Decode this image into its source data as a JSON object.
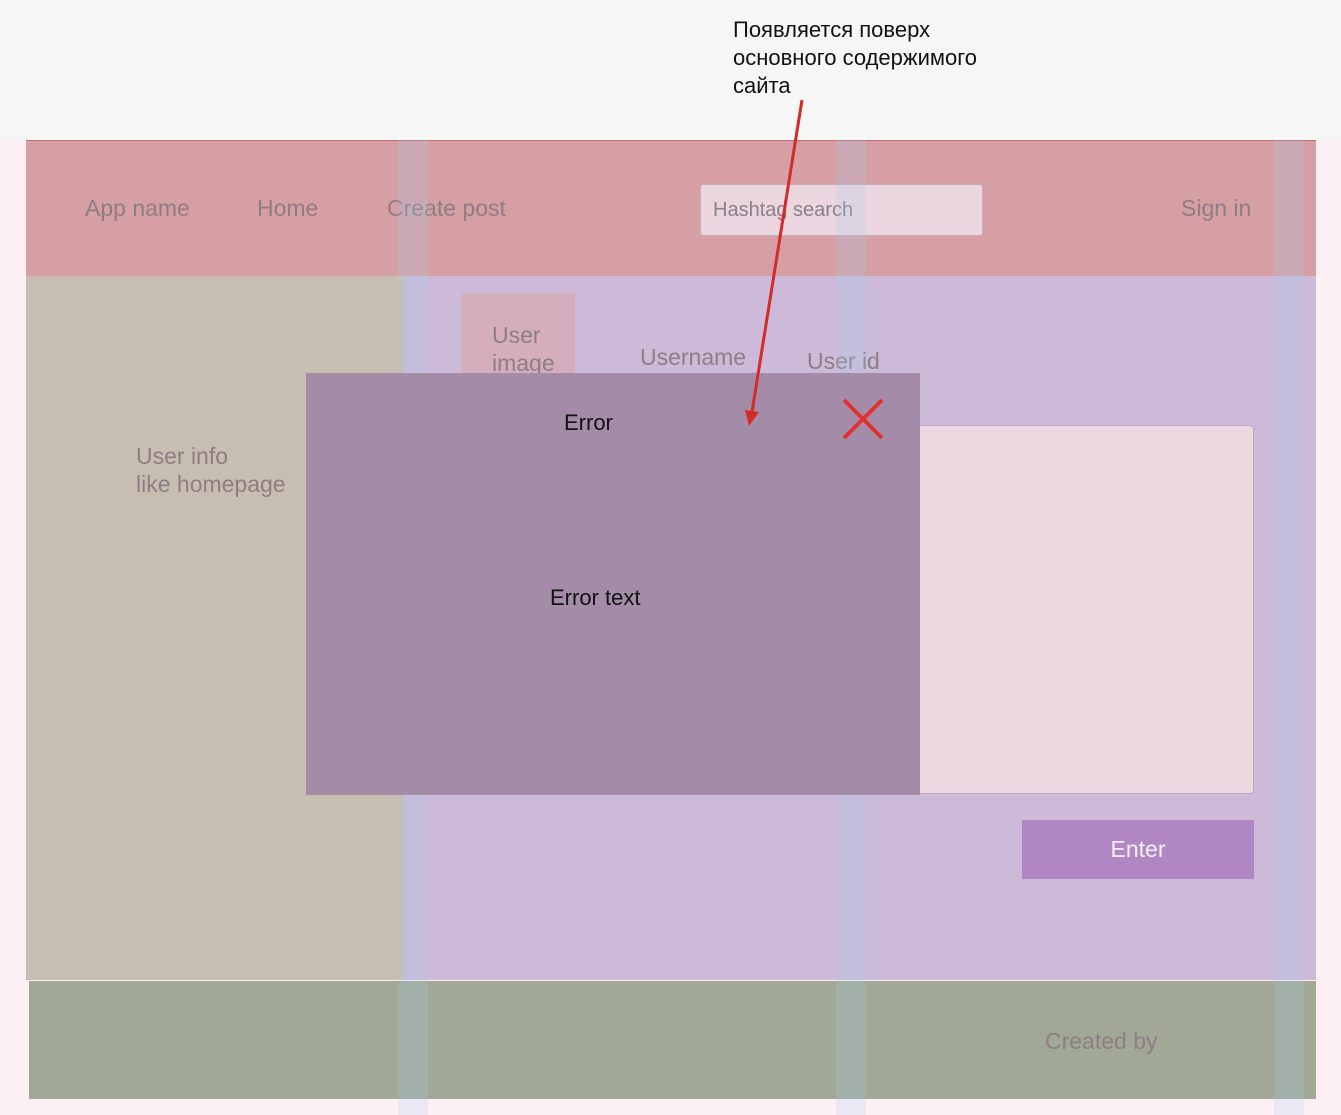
{
  "annotation": {
    "line1": "Появляется поверх",
    "line2": "основного содержимого",
    "line3": "сайта"
  },
  "header": {
    "app_name": "App name",
    "home": "Home",
    "create_post": "Create post",
    "search_placeholder": "Hashtag search",
    "sign_in": "Sign in"
  },
  "sidebar": {
    "text": "User info\nlike homepage"
  },
  "profile": {
    "user_image": "User\nimage",
    "username": "Username",
    "user_id": "User id"
  },
  "post_form": {
    "enter_label": "Enter"
  },
  "footer": {
    "created_by": "Created by"
  },
  "modal": {
    "title": "Error",
    "text": "Error text",
    "close_icon": "close-icon"
  },
  "colors": {
    "header": "#d59fa3",
    "sidebar": "#c7bdb0",
    "main": "#ccbad8",
    "footer": "#a1a895",
    "modal": "#a48ca9",
    "close_icon": "#e03030",
    "annotation_arrow": "#d42a2a",
    "enter_button": "#b087c3"
  }
}
